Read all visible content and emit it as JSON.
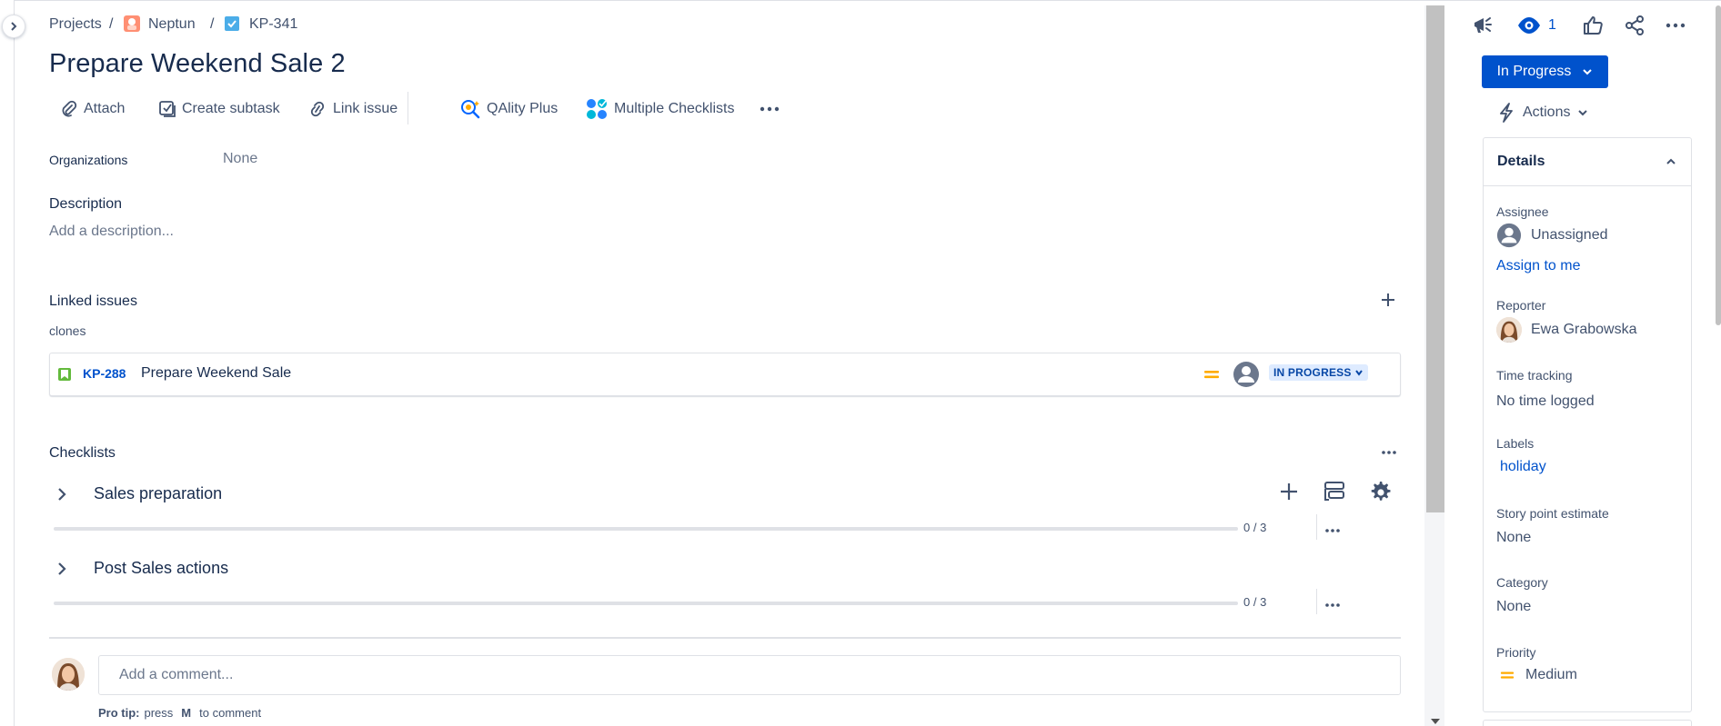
{
  "breadcrumb": {
    "projects": "Projects",
    "project": "Neptun",
    "issue_key": "KP-341",
    "separator": "/"
  },
  "issue": {
    "title": "Prepare Weekend Sale 2"
  },
  "toolbar": {
    "attach": "Attach",
    "create_subtask": "Create subtask",
    "link_issue": "Link issue",
    "qality_plus": "QAlity Plus",
    "multiple_checklists": "Multiple Checklists"
  },
  "fields": {
    "organizations_label": "Organizations",
    "organizations_value": "None",
    "description_label": "Description",
    "description_placeholder": "Add a description..."
  },
  "linked_issues": {
    "heading": "Linked issues",
    "relation": "clones",
    "items": [
      {
        "key": "KP-288",
        "summary": "Prepare Weekend Sale",
        "status": "IN PROGRESS"
      }
    ]
  },
  "checklists": {
    "heading": "Checklists",
    "items": [
      {
        "name": "Sales preparation",
        "progress": "0 / 3",
        "done": 0,
        "total": 3
      },
      {
        "name": "Post Sales actions",
        "progress": "0 / 3",
        "done": 0,
        "total": 3
      }
    ]
  },
  "comment": {
    "placeholder": "Add a comment...",
    "tip_prefix": "Pro tip:",
    "tip_press": "press",
    "tip_key": "M",
    "tip_suffix": "to comment"
  },
  "header_actions": {
    "watch_count": "1"
  },
  "status": {
    "label": "In Progress",
    "actions_label": "Actions"
  },
  "details": {
    "heading": "Details",
    "assignee_label": "Assignee",
    "assignee_value": "Unassigned",
    "assign_to_me": "Assign to me",
    "reporter_label": "Reporter",
    "reporter_value": "Ewa Grabowska",
    "time_tracking_label": "Time tracking",
    "time_tracking_value": "No time logged",
    "labels_label": "Labels",
    "labels_value": "holiday",
    "story_points_label": "Story point estimate",
    "story_points_value": "None",
    "category_label": "Category",
    "category_value": "None",
    "priority_label": "Priority",
    "priority_value": "Medium"
  },
  "colors": {
    "primary": "#0052cc",
    "text": "#172b4d",
    "subtle": "#42526e",
    "border": "#dfe1e6",
    "priority_medium": "#ffab00",
    "story_green": "#63ba3c",
    "lozenge_bg": "#deebff"
  },
  "icons": [
    "chevron-right-icon",
    "project-avatar-icon",
    "task-checkbox-icon",
    "paperclip-icon",
    "subtask-icon",
    "link-icon",
    "chevron-down-icon",
    "qality-plus-icon",
    "multiple-checklists-icon",
    "more-icon",
    "plus-icon",
    "story-icon",
    "priority-medium-icon",
    "unassigned-avatar-icon",
    "feedback-megaphone-icon",
    "eye-icon",
    "like-icon",
    "share-icon",
    "lightning-icon",
    "chevron-up-icon",
    "template-icon",
    "gear-icon"
  ]
}
